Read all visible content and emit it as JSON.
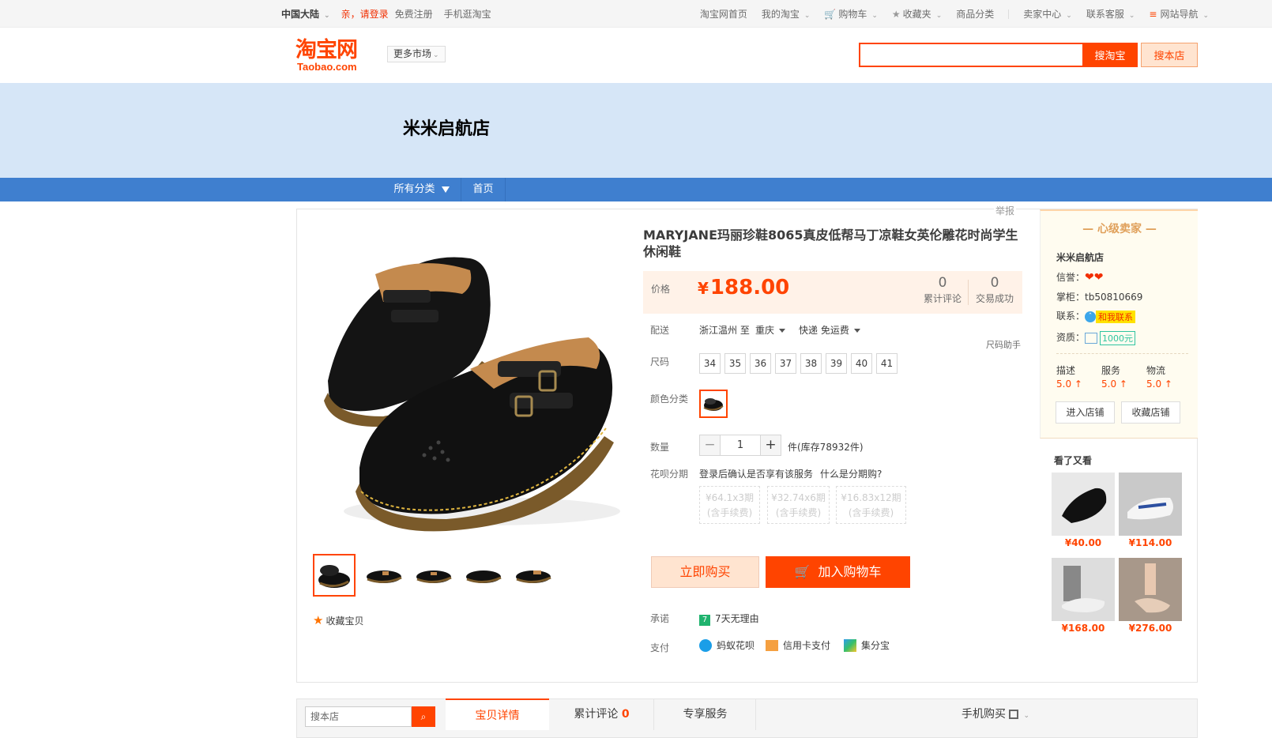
{
  "topbar": {
    "region": "中国大陆",
    "login": "亲，请登录",
    "register": "免费注册",
    "mobile": "手机逛淘宝",
    "home": "淘宝网首页",
    "my": "我的淘宝",
    "cart": "购物车",
    "fav": "收藏夹",
    "cats": "商品分类",
    "seller": "卖家中心",
    "service": "联系客服",
    "sitenav": "网站导航"
  },
  "header": {
    "logo_cn": "淘宝网",
    "logo_en": "Taobao.com",
    "more_market": "更多市场",
    "btn_taobao": "搜淘宝",
    "btn_shop": "搜本店"
  },
  "shop": {
    "name": "米米启航店",
    "all_cats": "所有分类",
    "home": "首页"
  },
  "product": {
    "report": "举报",
    "title": "MARYJANE玛丽珍鞋8065真皮低帮马丁凉鞋女英伦雕花时尚学生休闲鞋",
    "price_label": "价格",
    "currency": "¥",
    "price": "188.00",
    "reviews_count": "0",
    "reviews_label": "累计评论",
    "sales_count": "0",
    "sales_label": "交易成功",
    "ship_label": "配送",
    "ship_from": "浙江温州 至",
    "ship_to": "重庆",
    "ship_method": "快递 免运费",
    "size_helper": "尺码助手",
    "size_label": "尺码",
    "sizes": [
      "34",
      "35",
      "36",
      "37",
      "38",
      "39",
      "40",
      "41"
    ],
    "color_label": "颜色分类",
    "qty_label": "数量",
    "qty": "1",
    "stock": "件(库存78932件)",
    "huabei_label": "花呗分期",
    "huabei_note": "登录后确认是否享有该服务",
    "huabei_what": "什么是分期购?",
    "installments": [
      {
        "a": "¥64.1x3期",
        "b": "(含手续费)"
      },
      {
        "a": "¥32.74x6期",
        "b": "(含手续费)"
      },
      {
        "a": "¥16.83x12期",
        "b": "(含手续费)"
      }
    ],
    "buy_now": "立即购买",
    "add_cart": "加入购物车",
    "promise_label": "承诺",
    "promise": "7天无理由",
    "pay_label": "支付",
    "pay": [
      "蚂蚁花呗",
      "信用卡支付",
      "集分宝"
    ],
    "fav": "收藏宝贝"
  },
  "seller": {
    "level": "心级卖家",
    "shop": "米米启航店",
    "credit_label": "信誉：",
    "owner_label": "掌柜：",
    "owner": "tb50810669",
    "contact_label": "联系：",
    "contact": "和我联系",
    "qual_label": "资质：",
    "deposit": "1000元",
    "desc_label": "描述",
    "desc": "5.0",
    "serv_label": "服务",
    "serv": "5.0",
    "logi_label": "物流",
    "logi": "5.0",
    "enter": "进入店铺",
    "collect": "收藏店铺",
    "also": "看了又看",
    "also_prices": [
      "¥40.00",
      "¥114.00",
      "¥168.00",
      "¥276.00"
    ]
  },
  "bottom": {
    "search_placeholder": "搜本店",
    "tab_detail": "宝贝详情",
    "tab_reviews": "累计评论",
    "tab_reviews_n": "0",
    "tab_service": "专享服务",
    "mobile_buy": "手机购买"
  },
  "colors": {
    "accent": "#ff4400",
    "banner": "#d6e6f7",
    "catbar": "#3f7fcf"
  }
}
